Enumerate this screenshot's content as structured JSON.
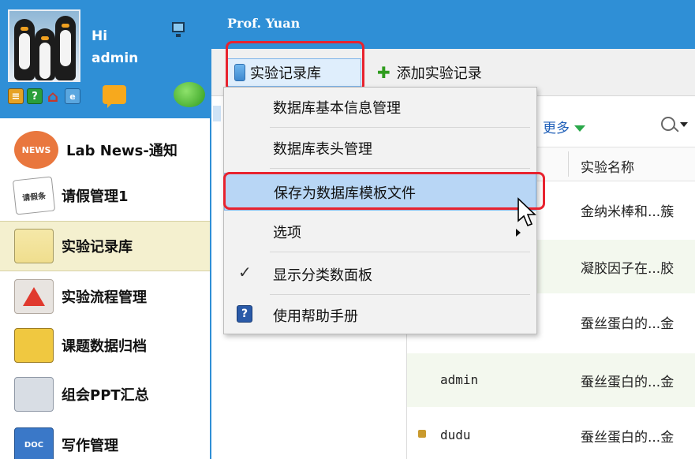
{
  "profile": {
    "greeting": "Hi",
    "username": "admin"
  },
  "quickbar": {
    "icons": [
      "document-icon",
      "help-icon",
      "home-icon",
      "ie-icon",
      "message-icon",
      "chat-bubble-icon"
    ],
    "help_glyph": "?",
    "home_glyph": "⌂",
    "ie_glyph": "e"
  },
  "nav": {
    "items": [
      {
        "label": "Lab News-通知",
        "icon": "news-icon",
        "icon_text": "NEWS"
      },
      {
        "label": "请假管理1",
        "icon": "leave-note-icon",
        "icon_text": "请假条"
      },
      {
        "label": "实验记录库",
        "icon": "notebook-icon",
        "active": true
      },
      {
        "label": "实验流程管理",
        "icon": "flask-icon"
      },
      {
        "label": "课题数据归档",
        "icon": "archive-icon"
      },
      {
        "label": "组会PPT汇总",
        "icon": "ppt-icon"
      },
      {
        "label": "写作管理",
        "icon": "doc-write-icon",
        "icon_text": "DOC"
      }
    ]
  },
  "header": {
    "title": "Prof. Yuan"
  },
  "toolbar": {
    "lab_button": "实验记录库",
    "add_button": "添加实验记录"
  },
  "grid": {
    "more_link": "更多",
    "column_name": "实验名称",
    "rows": [
      {
        "user": "",
        "name": "金纳米棒和...簇",
        "alt": false
      },
      {
        "user": "",
        "name": "凝胶因子在...胶",
        "alt": true
      },
      {
        "user": "",
        "name": "蚕丝蛋白的...金",
        "alt": false
      },
      {
        "user": "admin",
        "name": "蚕丝蛋白的...金",
        "alt": true
      },
      {
        "user": "dudu",
        "name": "蚕丝蛋白的...金",
        "alt": false,
        "locked": true
      }
    ]
  },
  "menu": {
    "items": [
      {
        "label": "数据库基本信息管理"
      },
      {
        "label": "数据库表头管理"
      },
      {
        "label": "保存为数据库模板文件",
        "highlighted": true
      },
      {
        "label": "选项"
      },
      {
        "label": "显示分类数面板",
        "checked": true
      },
      {
        "label": "使用帮助手册",
        "icon": "help-book-icon"
      }
    ],
    "check_glyph": "✓",
    "help_glyph": "?"
  },
  "colors": {
    "accent_blue": "#2f8fd6",
    "highlight_red": "#e8232f",
    "menu_highlight": "#b8d6f5"
  }
}
